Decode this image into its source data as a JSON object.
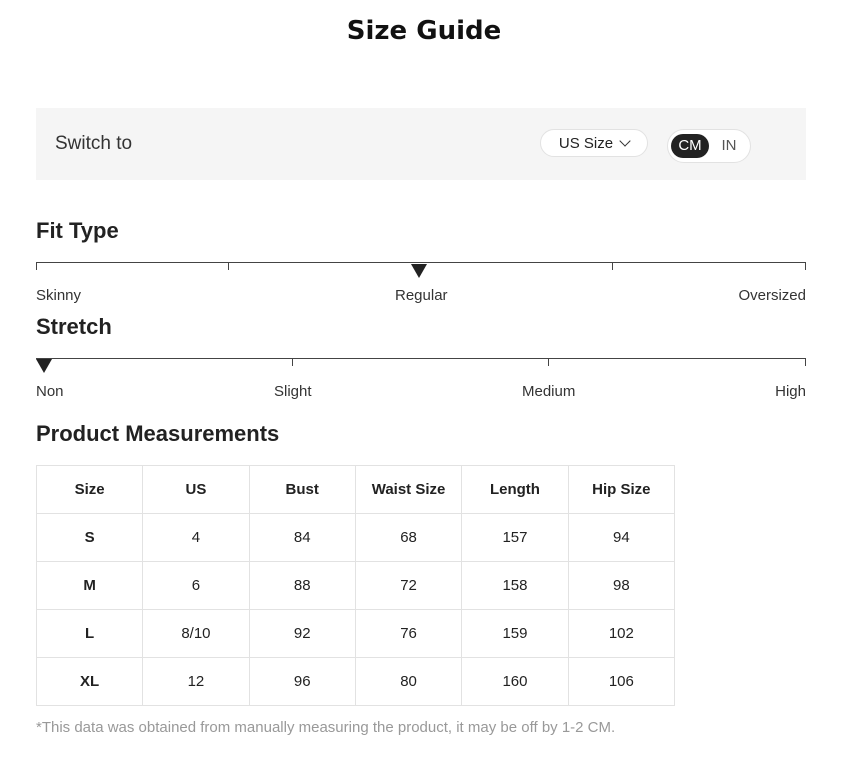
{
  "title": "Size Guide",
  "switch": {
    "label": "Switch to",
    "size_system": "US Size",
    "units": [
      "CM",
      "IN"
    ],
    "active_unit": "CM"
  },
  "fit_type": {
    "title": "Fit Type",
    "labels": [
      "Skinny",
      "Regular",
      "Oversized"
    ],
    "value": "Regular"
  },
  "stretch": {
    "title": "Stretch",
    "labels": [
      "Non",
      "Slight",
      "Medium",
      "High"
    ],
    "value": "Non"
  },
  "measurements": {
    "title": "Product Measurements",
    "headers": [
      "Size",
      "US",
      "Bust",
      "Waist Size",
      "Length",
      "Hip Size"
    ],
    "rows": [
      [
        "S",
        "4",
        "84",
        "68",
        "157",
        "94"
      ],
      [
        "M",
        "6",
        "88",
        "72",
        "158",
        "98"
      ],
      [
        "L",
        "8/10",
        "92",
        "76",
        "159",
        "102"
      ],
      [
        "XL",
        "12",
        "96",
        "80",
        "160",
        "106"
      ]
    ]
  },
  "note": "*This data was obtained from manually measuring the product, it may be off by 1-2 CM.",
  "colors": {
    "accent": "#222222",
    "panel": "#f5f5f5",
    "muted": "#999999"
  }
}
